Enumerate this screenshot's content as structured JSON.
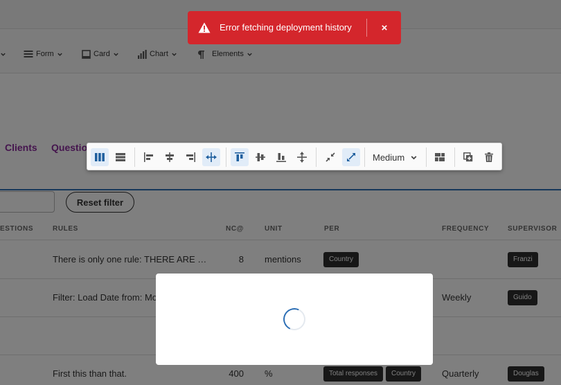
{
  "menubar": {
    "items": [
      {
        "label": "Form",
        "icon": "form-icon"
      },
      {
        "label": "Card",
        "icon": "card-icon"
      },
      {
        "label": "Chart",
        "icon": "chart-icon"
      },
      {
        "label": "Elements",
        "icon": "pilcrow-icon"
      }
    ]
  },
  "tabs": [
    {
      "label": "Clients"
    },
    {
      "label": "Questio"
    }
  ],
  "filter": {
    "reset_label": "Reset filter"
  },
  "table": {
    "columns": [
      "ESTIONS",
      "RULES",
      "NC@",
      "UNIT",
      "PER",
      "FREQUENCY",
      "SUPERVISOR"
    ],
    "rows": [
      {
        "rules": "There is only one rule: THERE ARE …",
        "nc": "8",
        "unit": "mentions",
        "per": [
          "Country"
        ],
        "frequency": "",
        "supervisor": "Franzi"
      },
      {
        "rules": "Filter: Load Date from: Mo",
        "nc": "",
        "unit": "",
        "per": [],
        "frequency": "Weekly",
        "supervisor": "Guido"
      },
      {
        "rules": "",
        "nc": "",
        "unit": "",
        "per": [],
        "frequency": "",
        "supervisor": ""
      },
      {
        "rules": "First this than that.",
        "nc": "400",
        "unit": "%",
        "per": [
          "Total responses",
          "Country"
        ],
        "frequency": "Quarterly",
        "supervisor": "Douglas"
      }
    ]
  },
  "toolbar": {
    "size_select": "Medium",
    "active": [
      "columns-layout",
      "fit-width",
      "align-top",
      "expand"
    ]
  },
  "toast": {
    "message": "Error fetching deployment history",
    "close_label": "×",
    "color": "#d4262c"
  },
  "colors": {
    "accent_blue": "#2d6fb5",
    "tab_purple": "#8a2b9c",
    "tag_dark": "#2f2f2f"
  }
}
